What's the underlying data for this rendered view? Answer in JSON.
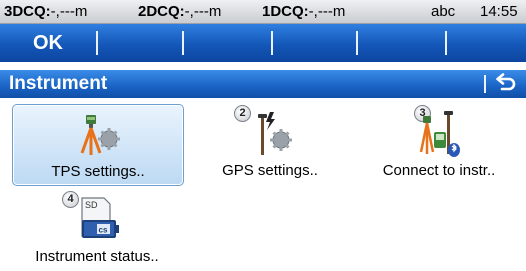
{
  "status_bar": {
    "dcq3_label": "3DCQ:",
    "dcq3_value": "-,---m",
    "dcq2_label": "2DCQ:",
    "dcq2_value": "-,---m",
    "dcq1_label": "1DCQ:",
    "dcq1_value": "-,---m",
    "input_mode": "abc",
    "time": "14:55"
  },
  "fn_keys": [
    "OK",
    "",
    "",
    "",
    "",
    ""
  ],
  "title_bar": {
    "title": "Instrument",
    "back_icon": "return-arrow-icon"
  },
  "tiles": [
    {
      "number": "",
      "label": "TPS settings..",
      "icon": "tps-tripod-gear-icon",
      "selected": true
    },
    {
      "number": "2",
      "label": "GPS settings..",
      "icon": "gps-pole-lightning-gear-icon",
      "selected": false
    },
    {
      "number": "3",
      "label": "Connect to instr..",
      "icon": "instruments-bluetooth-icon",
      "selected": false
    },
    {
      "number": "4",
      "label": "Instrument status..",
      "icon": "sd-card-cs-icon",
      "selected": false
    }
  ],
  "colors": {
    "accent_blue": "#1a63c4",
    "selection_fill": "#bcd9f3",
    "tripod_orange": "#e8721a"
  }
}
